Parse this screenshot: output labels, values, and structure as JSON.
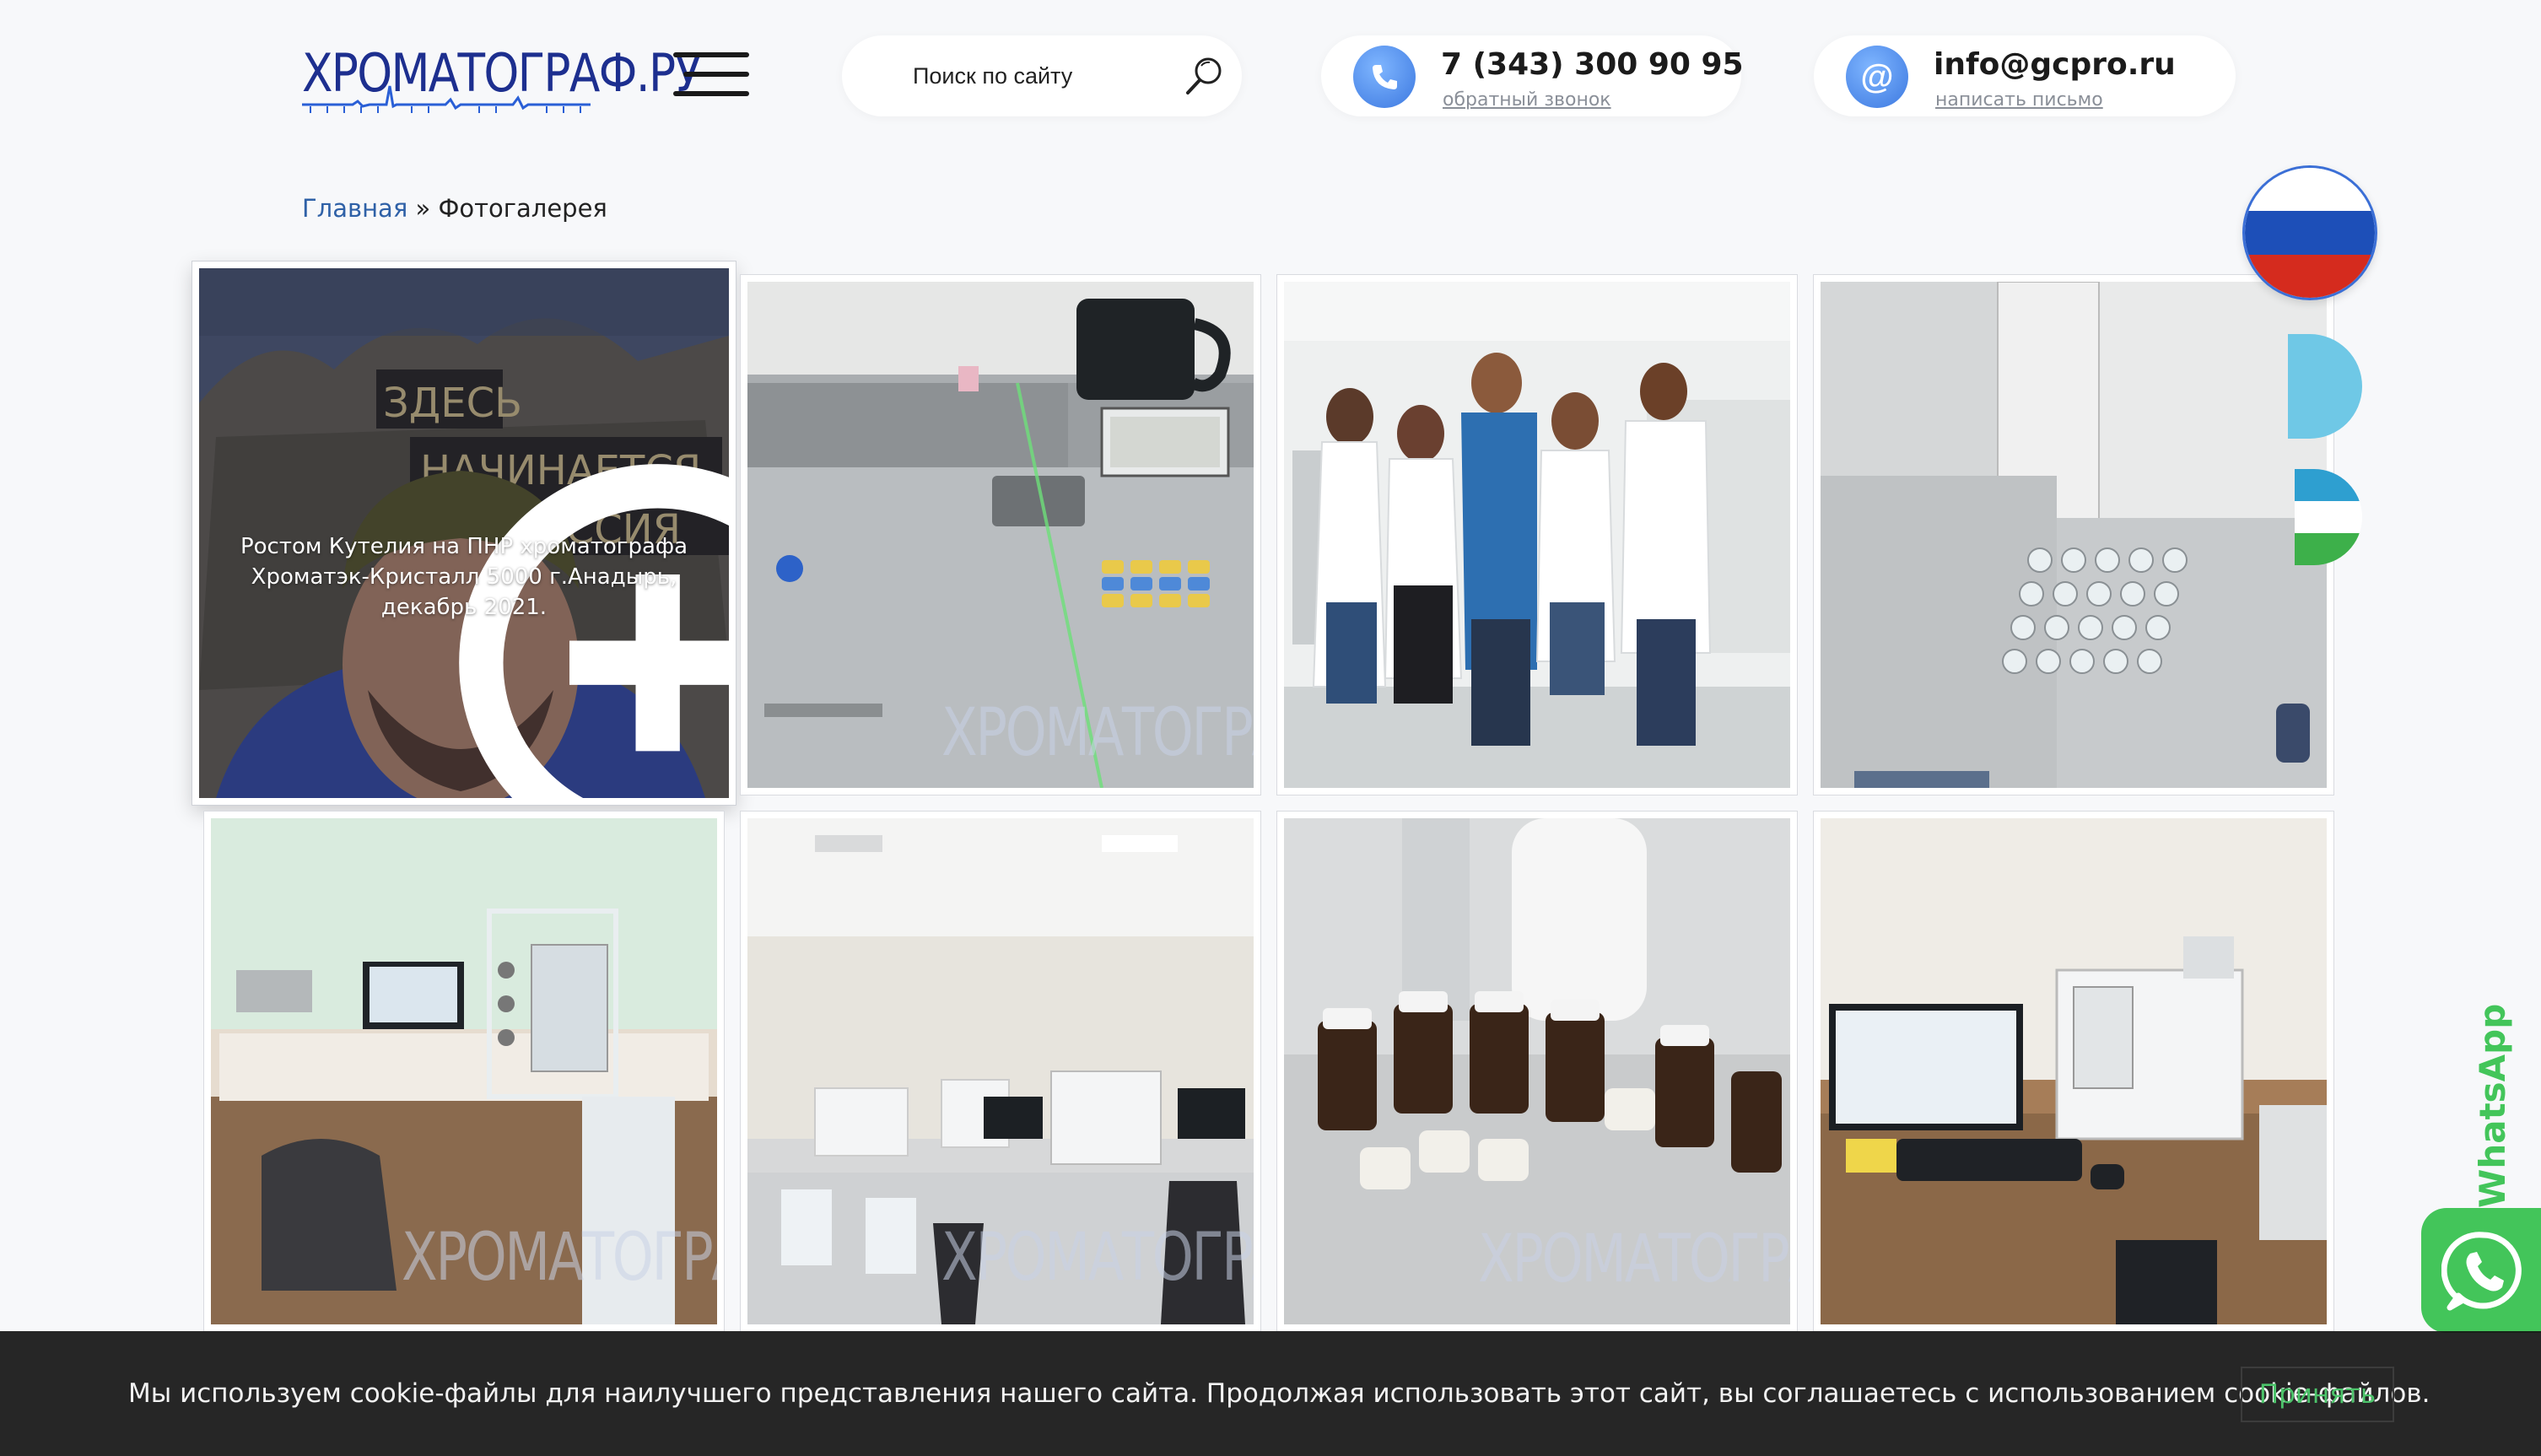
{
  "header": {
    "logo_text": "ХРОМАТОГРАФ.РУ",
    "search": {
      "placeholder": "Поиск по сайту"
    },
    "phone": {
      "number": "7 (343) 300 90 95",
      "callback_label": "обратный звонок"
    },
    "email": {
      "address": "info@gcpro.ru",
      "write_label": "написать письмо"
    },
    "icons": {
      "phone": "phone-icon",
      "email": "at-icon",
      "search": "magnifier-icon",
      "menu": "hamburger-icon"
    }
  },
  "breadcrumb": {
    "home": "Главная",
    "separator": " » ",
    "current": "Фотогалерея"
  },
  "gallery": {
    "watermark": "ХРОМАТОГРАФ",
    "items": [
      {
        "subject": "man-at-monument",
        "caption": "Ростом Кутелия на ПНР хроматографа Хроматэк-Кристалл 5000 г.Анадырь, декабрь 2021.",
        "sign_1": "ЗДЕСЬ",
        "sign_2": "НАЧИНАЕТСЯ",
        "sign_3": "РОССИЯ"
      },
      {
        "subject": "analyzer-with-mug"
      },
      {
        "subject": "team-in-lab-coats"
      },
      {
        "subject": "autosampler-vials"
      },
      {
        "subject": "lab-desk-with-laptop"
      },
      {
        "subject": "laboratory-room"
      },
      {
        "subject": "reagent-bottles"
      },
      {
        "subject": "chromatograph-with-monitor"
      }
    ]
  },
  "lang_switch": [
    {
      "code": "ru",
      "colors": [
        "#ffffff",
        "#1d4fb8",
        "#d52b1e"
      ]
    },
    {
      "code": "kz",
      "colors": [
        "#6fc8e6"
      ]
    },
    {
      "code": "uz",
      "colors": [
        "#2e9fd0",
        "#ffffff",
        "#3db04a"
      ]
    }
  ],
  "whatsapp": {
    "label": "WhatsApp",
    "color": "#43c55a"
  },
  "cookie": {
    "text": "Мы используем cookie-файлы для наилучшего представления нашего сайта. Продолжая использовать этот сайт, вы соглашаетесь с использованием cookie-файлов.",
    "accept_label": "Принять"
  }
}
